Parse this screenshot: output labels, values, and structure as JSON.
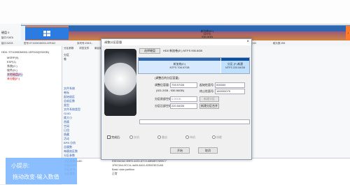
{
  "app": {
    "disk_label": "硬盘 0",
    "disk_info_short": "接口:SATA"
  },
  "diskbar": {
    "e_name": "新加卷(E:)",
    "e_fs": "NTFS",
    "e_size": "930.5GB"
  },
  "info_strip": {
    "items": [
      "接口:SATA",
      "型号:ST1000DM003-1ER162",
      "序列号:ZDE4...",
      "容量:931.5GB(953869MB)",
      "总扇区数:1953525168",
      "已分配扇区:",
      "每磁道扇区数:63",
      "磁头数:255"
    ]
  },
  "tree": {
    "items": [
      "HD0: ST1000DM003-1ER162(932GB)",
      "MSRP(0)",
      "ESP(1)",
      "系统(C:)",
      "软件(D:)",
      "本地磁盘(E:)",
      "未分配(F:)"
    ]
  },
  "tabs": [
    "分区参数",
    "浏览文件",
    "扇区编辑"
  ],
  "mid_links": [
    "分区",
    "卷",
    "文件系统",
    "卷标",
    "起始扇区",
    "总扇区数",
    "类型",
    "文件系统类型",
    "GUID",
    "簇大小",
    "首簇",
    "空闲",
    "已用",
    "隐藏",
    "活动",
    "BPB 分析",
    "总簇数",
    "每簇扇区数",
    "分区参数"
  ],
  "dialog": {
    "title": "调整分区容量",
    "close": "×",
    "disk_label": "选择硬盘",
    "disk_value": "HD0 新加卷(E:) NTFS 930.5GB",
    "preview_e_name": "新加卷(E:)",
    "preview_e_sub": "NTFS 708.97GB",
    "preview_f_name": "分区 (F:)新建",
    "preview_f_sub": "NTFS 220.54GB",
    "section_title": "(调整后的分区容量)",
    "new_size_label": "调整后容量:",
    "new_size_value": "709.97GB",
    "range_text": "(921.2GB - 930.56GB)",
    "start_label": "起始柱面号:",
    "start_value": "000000",
    "end_label": "终止柱面号:",
    "end_value": "160000079",
    "before_free_label": "分区前部空闲:",
    "before_free_value": "0.00GB",
    "before_free_note": "新建分区",
    "after_free_label": "分区后部空闲:",
    "after_free_value": "220.54GB",
    "after_free_note": "新建分区合并",
    "checkbox_label": "完成后:",
    "options": [
      "关机",
      "重启",
      "待机",
      "休眠"
    ],
    "start_button": "开始",
    "cancel_button": "取消"
  },
  "bottom": {
    "rows": [
      "分区类型GUID:",
      "分区GUID:",
      "分区名字:",
      "分区属性:"
    ],
    "vals": [
      "EBD0A0A2-B9E5-4433-87C0-68B6B72699C7",
      "1F8C3A4-9CCA-4a09-8A31-835923E21AB",
      "Basic data partition",
      "正常"
    ]
  },
  "overlay": {
    "title": "小提示:",
    "text": "拖动改变-输入数值"
  }
}
